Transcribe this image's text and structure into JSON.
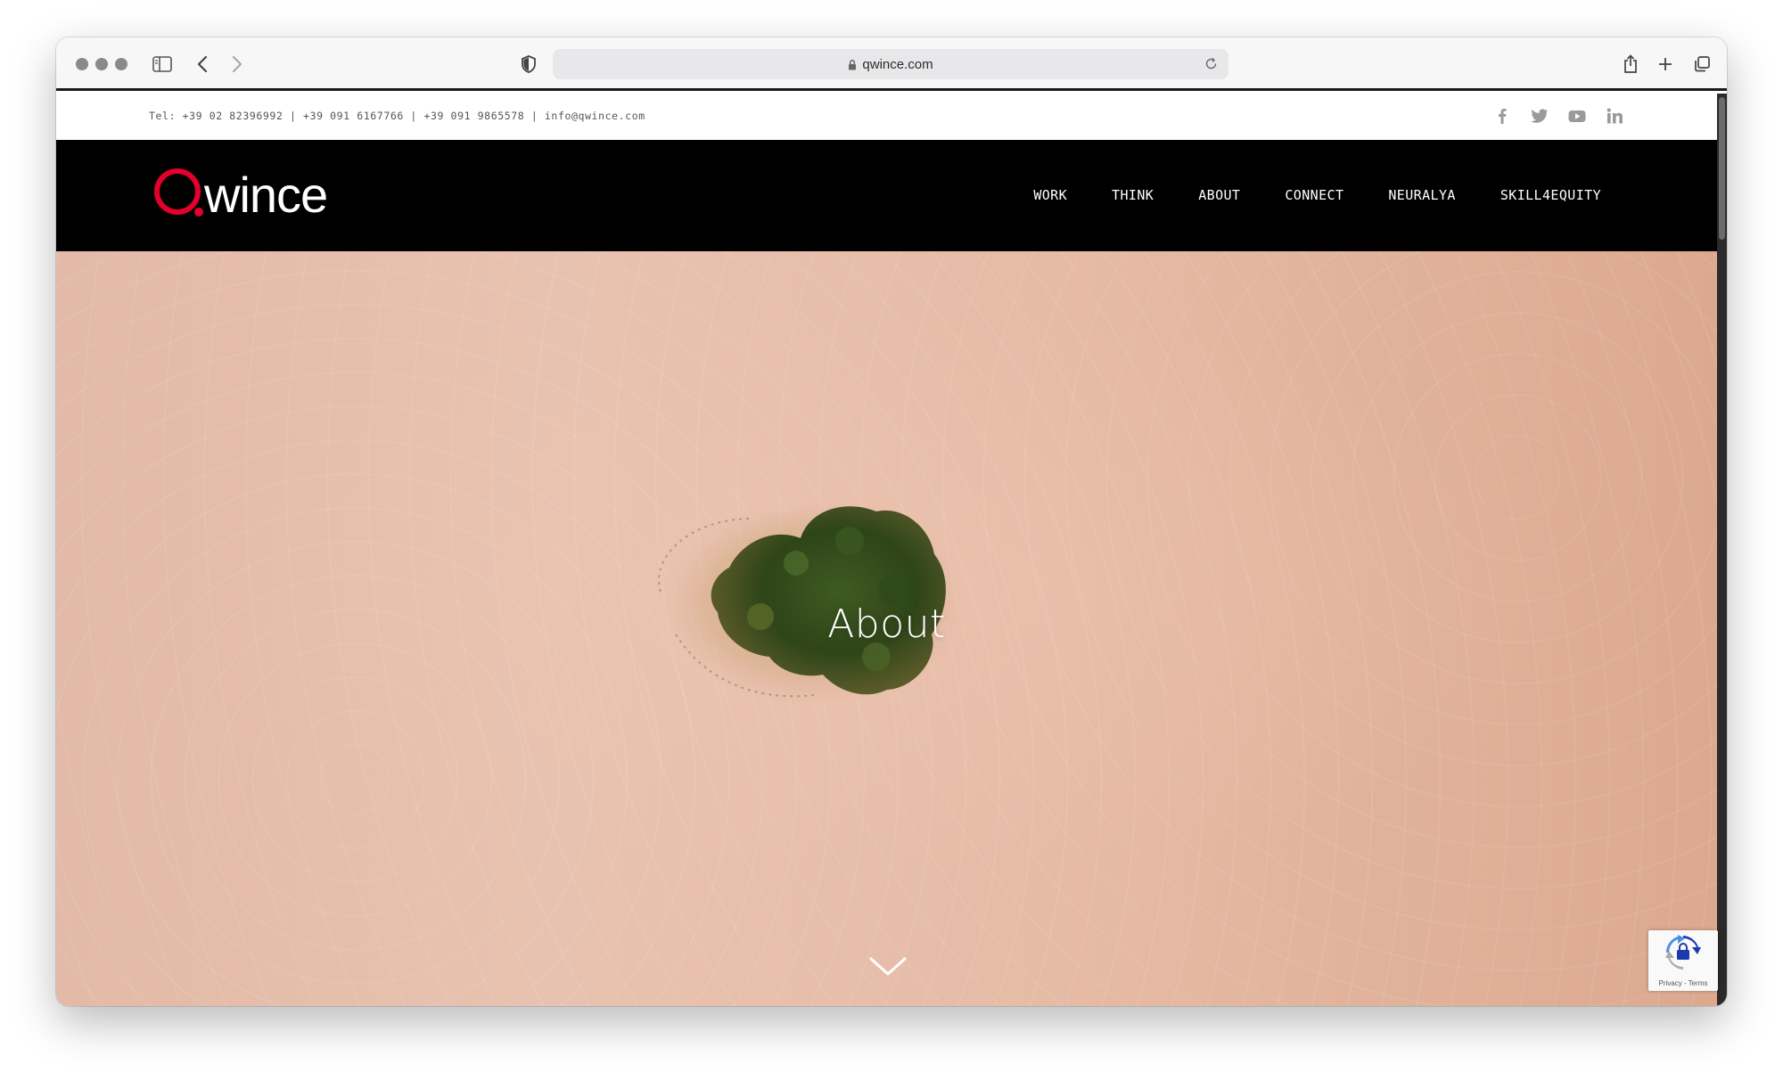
{
  "browser": {
    "url": "qwince.com"
  },
  "topbar": {
    "contact": "Tel: +39 02 82396992 | +39 091 6167766 | +39 091 9865578 | info@qwince.com",
    "socials": [
      "facebook-icon",
      "twitter-icon",
      "youtube-icon",
      "linkedin-icon"
    ]
  },
  "brand": {
    "logo_text": "wince",
    "accent_color": "#e4002b"
  },
  "nav": {
    "items": [
      {
        "label": "WORK"
      },
      {
        "label": "THINK"
      },
      {
        "label": "ABOUT"
      },
      {
        "label": "CONNECT"
      },
      {
        "label": "NEURALYA"
      },
      {
        "label": "SKILL4EQUITY"
      }
    ]
  },
  "hero": {
    "title": "About"
  },
  "recaptcha": {
    "terms": "Privacy - Terms"
  }
}
